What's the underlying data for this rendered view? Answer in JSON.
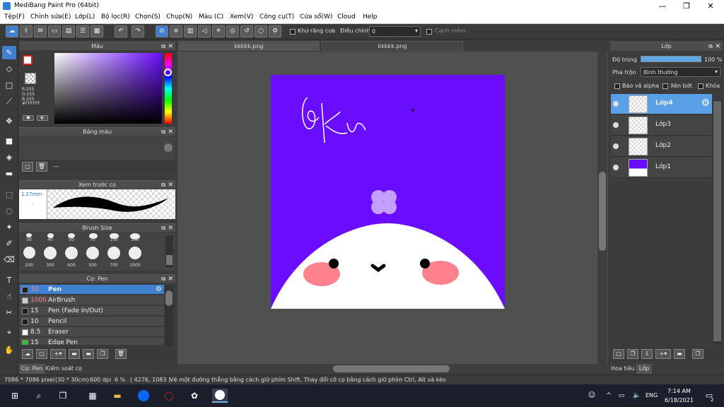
{
  "window": {
    "title": "MediBang Paint Pro (64bit)",
    "controls": [
      "—",
      "❐",
      "✕"
    ]
  },
  "menu": [
    "Tệp(F)",
    "Chỉnh sửa(E)",
    "Lớp(L)",
    "Bộ lọc(R)",
    "Chọn(S)",
    "Chụp(N)",
    "Màu (C)",
    "Xem(V)",
    "Công cụ(T)",
    "Cửa sổ(W)",
    "Cloud",
    "Help"
  ],
  "toolbar": {
    "antialias_label": "Khử răng cưa",
    "adjust_label": "Điều chỉnh",
    "adjust_value": "0",
    "snap_label": "Cạnh mềm"
  },
  "color_panel": {
    "title": "Màu",
    "rgb": "R:255\nG:255\nB:255",
    "hex": "#FFFFFF"
  },
  "palette_panel": {
    "title": "Bảng màu",
    "dash": "---"
  },
  "preview_panel": {
    "title": "Xem trước cọ",
    "size": "1.27mm"
  },
  "brush_size_panel": {
    "title": "Brush Size",
    "row1": [
      "30",
      "40",
      "50",
      "70",
      "100",
      "150"
    ],
    "row2": [
      "200",
      "300",
      "400",
      "500",
      "700",
      "1000"
    ]
  },
  "brush_panel": {
    "title": "Cọ: Pen",
    "items": [
      {
        "size": "30",
        "name": "Pen",
        "color": "#1f1f1f",
        "active": true
      },
      {
        "size": "1000",
        "name": "AirBrush",
        "color": "#cfcfcf",
        "active": false
      },
      {
        "size": "15",
        "name": "Pen (Fade In/Out)",
        "color": "#1f1f1f",
        "active": false
      },
      {
        "size": "10",
        "name": "Pencil",
        "color": "#1f1f1f",
        "active": false
      },
      {
        "size": "8.5",
        "name": "Eraser",
        "color": "#ffffff",
        "active": false
      },
      {
        "size": "15",
        "name": "Edge Pen",
        "color": "#2fbf2f",
        "active": false
      }
    ]
  },
  "left_tabs": [
    "Cọ: Pen",
    "Kiểm soát cọ"
  ],
  "doc_tabs": [
    "kkkkk.png",
    "kkkkk.png"
  ],
  "layers_panel": {
    "title": "Lớp",
    "opacity_label": "Độ trong",
    "opacity_value": "100 %",
    "blend_label": "Pha trộn",
    "blend_value": "Bình thường",
    "checks": [
      "Bảo vệ alpha",
      "Xén bớt",
      "Khóa"
    ],
    "layers": [
      "Lớp4",
      "Lớp3",
      "Lớp2",
      "Lớp1"
    ]
  },
  "right_tabs": [
    "Hoa tiêu",
    "Lớp"
  ],
  "status": {
    "dims": "7086 * 7086 pixel",
    "cm": "(30 * 30cm)",
    "dpi": "600 dpi",
    "zoom": "6 %",
    "coords": "( 4276, 1083 )",
    "hint": "Vẽ một đường thẳng bằng cách giữ phím Shift, Thay đổi cỡ cọ bằng cách giữ phím Ctrl, Alt và kéo"
  },
  "taskbar": {
    "lang": "ENG",
    "time": "7:14 AM",
    "date": "6/18/2021",
    "notif": "2"
  },
  "colors": {
    "canvas_bg": "#6a0dff",
    "accent": "#3f80d0"
  }
}
